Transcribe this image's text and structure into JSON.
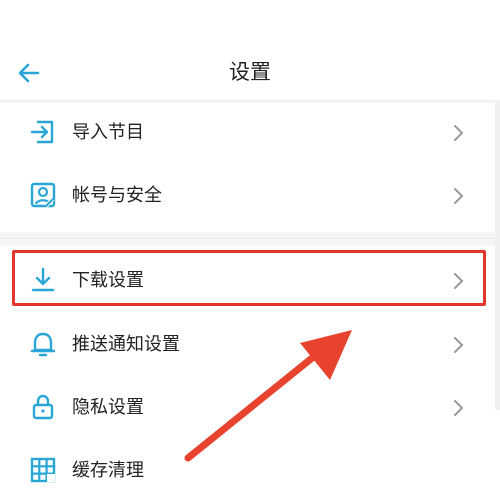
{
  "header": {
    "title": "设置",
    "back_icon": "arrow-left-icon"
  },
  "settings": [
    {
      "label": "导入节目",
      "icon": "import-icon"
    },
    {
      "label": "帐号与安全",
      "icon": "account-security-icon"
    },
    {
      "label": "下载设置",
      "icon": "download-icon",
      "highlighted": true
    },
    {
      "label": "推送通知设置",
      "icon": "bell-icon"
    },
    {
      "label": "隐私设置",
      "icon": "lock-icon"
    },
    {
      "label": "缓存清理",
      "icon": "cache-grid-icon"
    }
  ],
  "colors": {
    "accent": "#2aa6d6",
    "highlight": "#e0362b",
    "text": "#222222",
    "chevron": "#9a9a9a"
  }
}
